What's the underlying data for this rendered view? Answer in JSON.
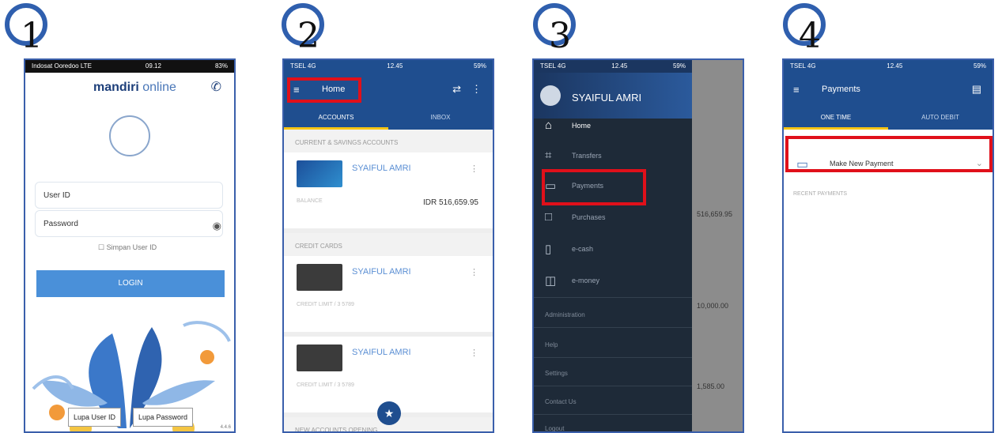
{
  "steps": [
    "1",
    "2",
    "3",
    "4"
  ],
  "login": {
    "status_left": "Indosat Ooredoo LTE",
    "status_time": "09.12",
    "status_right": "83%",
    "brand_bold": "mandiri",
    "brand_light": " online",
    "phone_icon": "phone-icon",
    "user_id_placeholder": "User ID",
    "password_placeholder": "Password",
    "remember": "Simpan User ID",
    "login_button": "LOGIN",
    "forgot_user": "Lupa User ID",
    "forgot_password": "Lupa Password",
    "version": "4.4.6"
  },
  "home": {
    "status_left": "TSEL 4G",
    "status_time": "12.45",
    "status_right": "59%",
    "title": "Home",
    "tabs": [
      "ACCOUNTS",
      "INBOX"
    ],
    "section_accounts": "CURRENT & SAVINGS ACCOUNTS",
    "account_name": "SYAIFUL AMRI",
    "balance_label": "BALANCE",
    "balance": "IDR 516,659.95",
    "section_cards": "CREDIT CARDS",
    "card1_name": "SYAIFUL AMRI",
    "card1_sub": "CREDIT LIMIT / 3 5789",
    "card2_name": "SYAIFUL AMRI",
    "card2_sub": "CREDIT LIMIT / 3 5789",
    "section_new": "NEW ACCOUNTS OPENING",
    "colors": {
      "primary": "#1f4e8f",
      "accent": "#f7c514",
      "highlight": "#e0101a"
    }
  },
  "drawer": {
    "status_left": "TSEL 4G",
    "status_time": "12.45",
    "status_right": "59%",
    "user_name": "SYAIFUL AMRI",
    "items": [
      {
        "label": "Home",
        "icon": "home-icon"
      },
      {
        "label": "Transfers",
        "icon": "bank-icon"
      },
      {
        "label": "Payments",
        "icon": "payment-card-icon"
      },
      {
        "label": "Purchases",
        "icon": "cart-icon"
      },
      {
        "label": "e-cash",
        "icon": "phone-icon"
      },
      {
        "label": "e-money",
        "icon": "wallet-icon"
      }
    ],
    "sections": [
      "Administration",
      "Help",
      "Settings",
      "Contact Us",
      "Logout"
    ],
    "behind_amounts": [
      "516,659.95",
      "10,000.00",
      "1,585.00"
    ]
  },
  "payments": {
    "status_left": "TSEL 4G",
    "status_time": "12.45",
    "status_right": "59%",
    "title": "Payments",
    "tabs": [
      "ONE TIME",
      "AUTO DEBIT"
    ],
    "make_new": "Make New Payment",
    "recent": "RECENT PAYMENTS"
  }
}
